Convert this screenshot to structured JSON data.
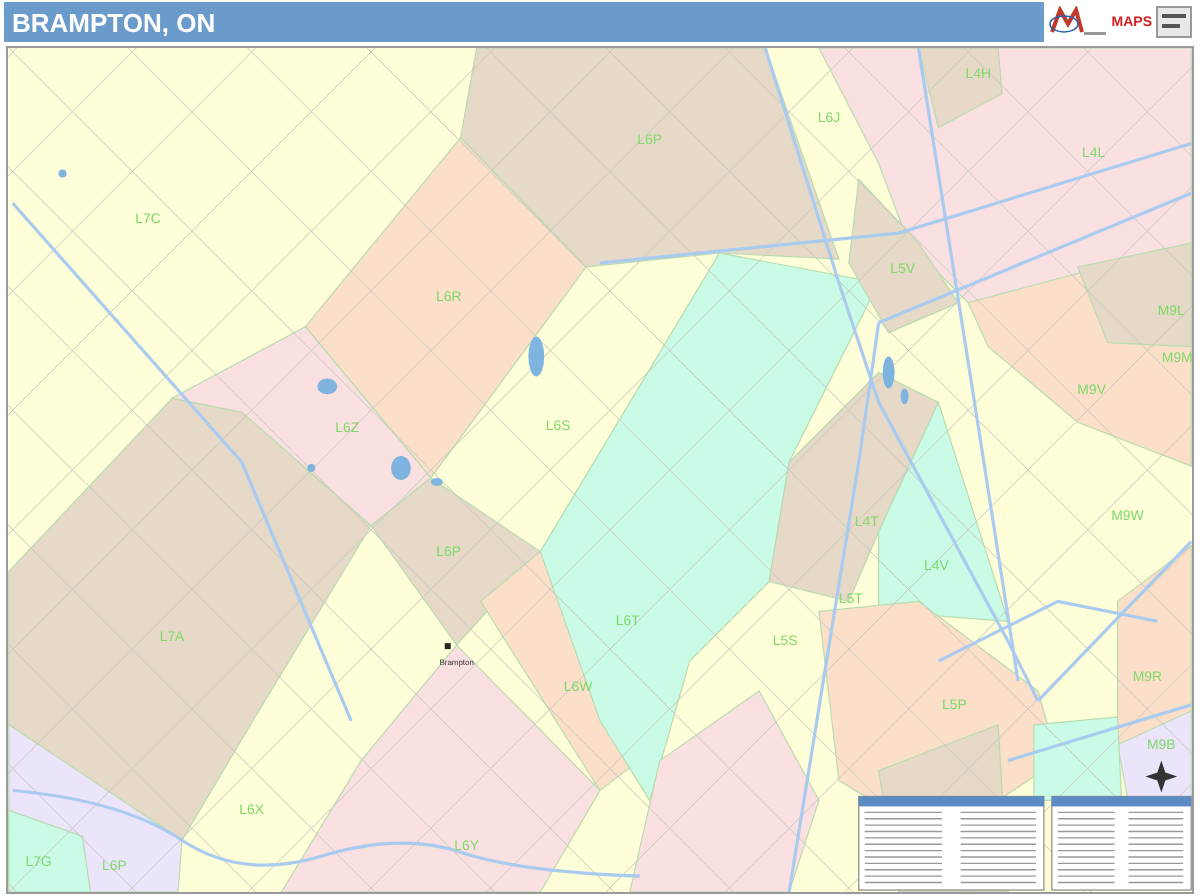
{
  "header": {
    "title": "BRAMPTON, ON",
    "logo_text": "MAPS"
  },
  "map": {
    "labels": [
      "L7C",
      "L6R",
      "L6P",
      "L6J",
      "L4H",
      "L4L",
      "L5V",
      "L6Z",
      "L6S",
      "M9L",
      "M9M",
      "M9V",
      "L6P",
      "L7A",
      "L6W",
      "L4T",
      "L4V",
      "L6T",
      "L5T",
      "L5S",
      "M9W",
      "L5P",
      "M9R",
      "M9B",
      "L6X",
      "L6Y",
      "L7G",
      "L6P"
    ],
    "city_label": "Brampton"
  }
}
